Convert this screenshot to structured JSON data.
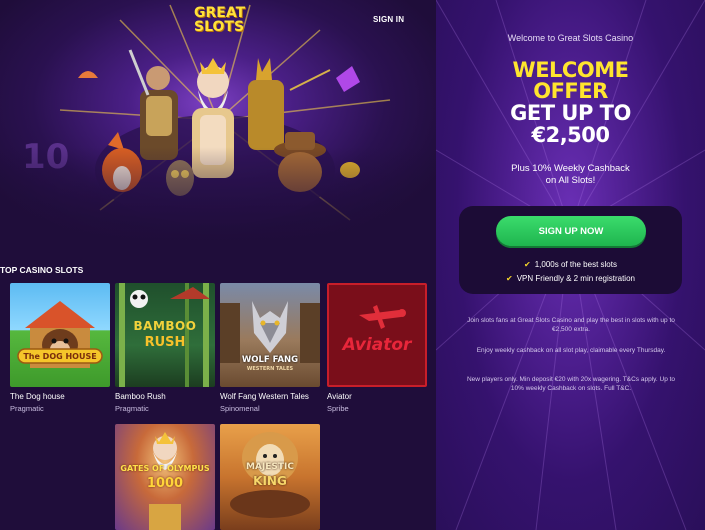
{
  "header": {
    "logo_line1": "GREAT",
    "logo_line2": "SLOTS",
    "signin_label": "SIGN IN"
  },
  "section": {
    "title": "TOP CASINO SLOTS"
  },
  "games": [
    {
      "name": "The Dog house",
      "provider": "Pragmatic",
      "art_title": "The DOG HOUSE"
    },
    {
      "name": "Bamboo Rush",
      "provider": "Pragmatic",
      "art_title_1": "BAMBOO",
      "art_title_2": "RUSH"
    },
    {
      "name": "Wolf Fang Western Tales",
      "provider": "Spinomenal",
      "art_title_1": "WOLF FANG",
      "art_title_2": "WESTERN TALES"
    },
    {
      "name": "Aviator",
      "provider": "Spribe",
      "art_title": "Aviator"
    },
    {
      "art_title_1": "GATES OF OLYMPUS",
      "art_title_2": "1000"
    },
    {
      "art_title_1": "MAJESTIC",
      "art_title_2": "KING"
    }
  ],
  "offer": {
    "welcome_small": "Welcome to Great Slots Casino",
    "line1": "WELCOME",
    "line2": "OFFER",
    "line3": "GET UP TO",
    "line4": "€2,500",
    "cashback_1": "Plus 10% Weekly Cashback",
    "cashback_2": "on All Slots!",
    "cta_label": "SIGN UP NOW",
    "feature_1": "1,000s of the best slots",
    "feature_2": "VPN Friendly & 2 min registration",
    "fine_1": "Join slots fans at Great Slots Casino and play the best in slots with up to €2,500 extra.",
    "fine_2": "Enjoy weekly cashback on all slot play, claimable every Thursday.",
    "fine_3": "New players only. Min deposit €20 with 20x wagering. T&Cs apply. Up to 10% weekly Cashback on slots. Full T&C."
  },
  "colors": {
    "brand_yellow": "#ffe52e",
    "cta_green": "#2bc95a",
    "panel_dark": "#1f0d3a",
    "right_purple": "#4b1d8c"
  },
  "icons": [
    "check-icon",
    "logo-icon"
  ]
}
